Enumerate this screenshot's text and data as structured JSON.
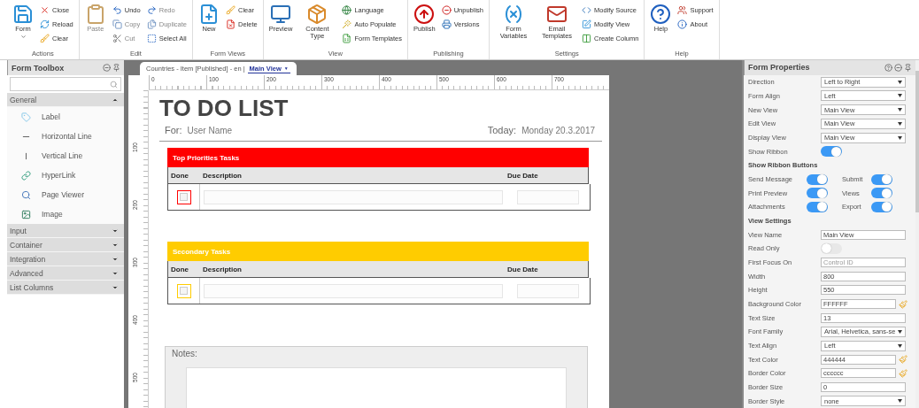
{
  "ribbon": {
    "groups": [
      {
        "label": "Actions",
        "items": [
          {
            "kind": "large",
            "label": "Form",
            "menu": true,
            "disabled": false
          },
          {
            "kind": "stack",
            "items": [
              {
                "label": "Close",
                "disabled": false
              },
              {
                "label": "Reload",
                "disabled": false
              },
              {
                "label": "Clear",
                "disabled": false
              }
            ]
          }
        ]
      },
      {
        "label": "Edit",
        "items": [
          {
            "kind": "large",
            "label": "Paste",
            "menu": false,
            "disabled": true
          },
          {
            "kind": "stack",
            "items": [
              {
                "label": "Undo",
                "disabled": false
              },
              {
                "label": "Copy",
                "disabled": true
              },
              {
                "label": "Cut",
                "disabled": true
              }
            ]
          },
          {
            "kind": "stack",
            "items": [
              {
                "label": "Redo",
                "disabled": true
              },
              {
                "label": "Duplicate",
                "disabled": true
              },
              {
                "label": "Select All",
                "disabled": false
              }
            ]
          }
        ]
      },
      {
        "label": "Form Views",
        "items": [
          {
            "kind": "large",
            "label": "New",
            "menu": false,
            "disabled": false
          },
          {
            "kind": "stack",
            "items": [
              {
                "label": "Clear",
                "disabled": false
              },
              {
                "label": "Delete",
                "disabled": false
              }
            ]
          }
        ]
      },
      {
        "label": "View",
        "items": [
          {
            "kind": "large",
            "label": "Preview",
            "menu": false,
            "disabled": false
          },
          {
            "kind": "large",
            "label": "Content Type",
            "menu": false,
            "disabled": false
          },
          {
            "kind": "stack",
            "items": [
              {
                "label": "Language",
                "disabled": false
              },
              {
                "label": "Auto Populate",
                "disabled": false
              },
              {
                "label": "Form Templates",
                "disabled": false
              }
            ]
          }
        ]
      },
      {
        "label": "Publishing",
        "items": [
          {
            "kind": "large",
            "label": "Publish",
            "menu": false,
            "disabled": false
          },
          {
            "kind": "stack",
            "items": [
              {
                "label": "Unpublish",
                "disabled": false
              },
              {
                "label": "Versions",
                "disabled": false
              }
            ]
          }
        ]
      },
      {
        "label": "Settings",
        "items": [
          {
            "kind": "large",
            "label": "Form Variables",
            "menu": false,
            "disabled": false
          },
          {
            "kind": "large",
            "label": "Email Templates",
            "menu": false,
            "disabled": false
          },
          {
            "kind": "stack",
            "items": [
              {
                "label": "Modify Source",
                "disabled": false
              },
              {
                "label": "Modify View",
                "disabled": false
              },
              {
                "label": "Create Column",
                "disabled": false
              }
            ]
          }
        ]
      },
      {
        "label": "Help",
        "items": [
          {
            "kind": "large",
            "label": "Help",
            "menu": false,
            "disabled": false
          },
          {
            "kind": "stack",
            "items": [
              {
                "label": "Support",
                "disabled": false
              },
              {
                "label": "About",
                "disabled": false
              }
            ]
          }
        ]
      }
    ]
  },
  "toolbox": {
    "title": "Form Toolbox",
    "sections": [
      {
        "label": "General",
        "expanded": true,
        "items": [
          "Label",
          "Horizontal Line",
          "Vertical Line",
          "HyperLink",
          "Page Viewer",
          "Image"
        ]
      },
      {
        "label": "Input",
        "expanded": false
      },
      {
        "label": "Container",
        "expanded": false
      },
      {
        "label": "Integration",
        "expanded": false
      },
      {
        "label": "Advanced",
        "expanded": false
      },
      {
        "label": "List Columns",
        "expanded": false
      }
    ]
  },
  "editor": {
    "tab": {
      "title": "Countries - Item [Published] - en |",
      "view": "Main View",
      "view_caret": "▼"
    },
    "ruler": {
      "x_labels": [
        "0",
        "100",
        "200",
        "300",
        "400",
        "500",
        "600",
        "700"
      ],
      "y_labels": [
        "100",
        "200",
        "300",
        "400",
        "500"
      ]
    },
    "form": {
      "title": "TO DO LIST",
      "for_label": "For:",
      "for_value": "User Name",
      "today_label": "Today:",
      "today_value": "Monday 20.3.2017",
      "sections": [
        {
          "title": "Top Priorities Tasks",
          "color": "#ff0000",
          "columns": [
            "Done",
            "Description",
            "Due Date"
          ],
          "rows": [
            {
              "done": false
            }
          ]
        },
        {
          "title": "Secondary Tasks",
          "color": "#ffcc00",
          "columns": [
            "Done",
            "Description",
            "Due Date"
          ],
          "rows": [
            {
              "done": false
            }
          ]
        }
      ],
      "notes": {
        "label": "Notes:"
      }
    }
  },
  "properties": {
    "title": "Form Properties",
    "rows": [
      {
        "kind": "select",
        "label": "Direction",
        "value": "Left to Right"
      },
      {
        "kind": "select",
        "label": "Form Align",
        "value": "Left"
      },
      {
        "kind": "select",
        "label": "New View",
        "value": "Main View"
      },
      {
        "kind": "select",
        "label": "Edit View",
        "value": "Main View"
      },
      {
        "kind": "select",
        "label": "Display View",
        "value": "Main View"
      },
      {
        "kind": "toggle",
        "label": "Show Ribbon",
        "on": true
      },
      {
        "kind": "heading",
        "label": "Show Ribbon Buttons"
      },
      {
        "kind": "pair",
        "left": {
          "label": "Send Message",
          "on": true
        },
        "right": {
          "label": "Submit",
          "on": true
        }
      },
      {
        "kind": "pair",
        "left": {
          "label": "Print Preview",
          "on": true
        },
        "right": {
          "label": "Views",
          "on": true
        }
      },
      {
        "kind": "pair",
        "left": {
          "label": "Attachments",
          "on": true
        },
        "right": {
          "label": "Export",
          "on": true
        }
      },
      {
        "kind": "heading",
        "label": "View Settings"
      },
      {
        "kind": "text",
        "label": "View Name",
        "value": "Main View"
      },
      {
        "kind": "toggle",
        "label": "Read Only",
        "on": false
      },
      {
        "kind": "text",
        "label": "First Focus On",
        "placeholder": "Control ID"
      },
      {
        "kind": "text",
        "label": "Width",
        "value": "800"
      },
      {
        "kind": "text",
        "label": "Height",
        "value": "550"
      },
      {
        "kind": "color",
        "label": "Background Color",
        "value": "FFFFFF"
      },
      {
        "kind": "text",
        "label": "Text Size",
        "value": "13"
      },
      {
        "kind": "select",
        "label": "Font Family",
        "value": "Arial, Helvetica, sans-se"
      },
      {
        "kind": "select",
        "label": "Text Align",
        "value": "Left"
      },
      {
        "kind": "color",
        "label": "Text Color",
        "value": "444444"
      },
      {
        "kind": "color",
        "label": "Border Color",
        "value": "cccccc"
      },
      {
        "kind": "text",
        "label": "Border Size",
        "value": "0"
      },
      {
        "kind": "select",
        "label": "Border Style",
        "value": "none"
      }
    ]
  }
}
